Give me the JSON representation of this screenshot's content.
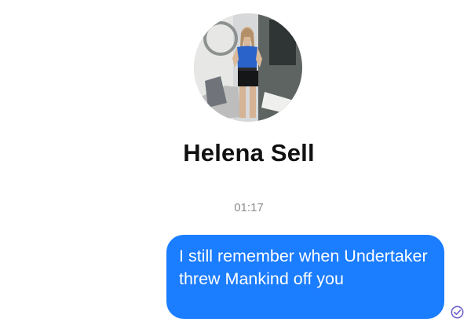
{
  "contact": {
    "name": "Helena Sell",
    "avatar_icon": "profile-photo"
  },
  "conversation": {
    "timestamp": "01:17",
    "messages": [
      {
        "direction": "outgoing",
        "text": "I still remember when Undertaker threw Mankind off you",
        "status_icon": "check-circle-icon"
      }
    ]
  },
  "colors": {
    "bubble_outgoing": "#1b7dff",
    "status_icon": "#6e63c9",
    "timestamp": "#8a8d91",
    "name": "#111111"
  }
}
